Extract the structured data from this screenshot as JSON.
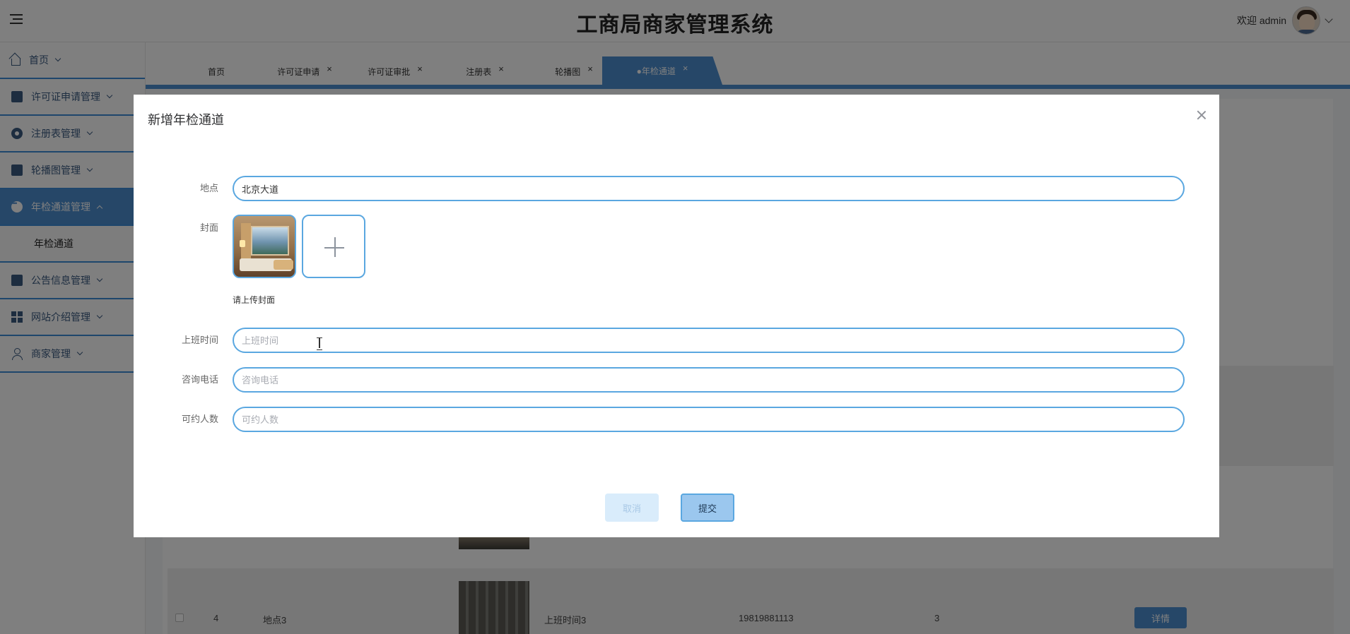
{
  "header": {
    "title": "工商局商家管理系统",
    "welcome": "欢迎 admin"
  },
  "sidebar": {
    "items": [
      {
        "label": "首页",
        "icon": "home-icon"
      },
      {
        "label": "许可证申请管理",
        "icon": "briefcase-icon"
      },
      {
        "label": "注册表管理",
        "icon": "circle-icon"
      },
      {
        "label": "轮播图管理",
        "icon": "toolbox-icon"
      },
      {
        "label": "年检通道管理",
        "icon": "more-icon",
        "active": true
      },
      {
        "label": "年检通道",
        "sub": true
      },
      {
        "label": "公告信息管理",
        "icon": "copy-icon"
      },
      {
        "label": "网站介绍管理",
        "icon": "grid-icon"
      },
      {
        "label": "商家管理",
        "icon": "user-icon"
      }
    ]
  },
  "tabs": [
    {
      "label": "首页"
    },
    {
      "label": "许可证申请",
      "close": "×"
    },
    {
      "label": "许可证审批",
      "close": "×"
    },
    {
      "label": "注册表",
      "close": "×"
    },
    {
      "label": "轮播图",
      "close": "×"
    },
    {
      "label": "●年检通道",
      "close": "×",
      "active": true
    }
  ],
  "background_table": {
    "row": {
      "index": "4",
      "location": "地点3",
      "work_time": "上班时间3",
      "phone": "19819881113",
      "capacity": "3",
      "action": "详情"
    }
  },
  "dialog": {
    "title": "新增年检通道",
    "fields": {
      "location": {
        "label": "地点",
        "value": "北京大道"
      },
      "cover": {
        "label": "封面",
        "tip": "请上传封面"
      },
      "work_time": {
        "label": "上班时间",
        "placeholder": "上班时间",
        "value": ""
      },
      "phone": {
        "label": "咨询电话",
        "placeholder": "咨询电话",
        "value": ""
      },
      "capacity": {
        "label": "可约人数",
        "placeholder": "可约人数",
        "value": ""
      }
    },
    "buttons": {
      "cancel": "取消",
      "submit": "提交"
    }
  },
  "colors": {
    "accent": "#4d8fd1",
    "input_border": "#5aa7e0",
    "overlay": "rgba(0,0,0,0.5)"
  }
}
